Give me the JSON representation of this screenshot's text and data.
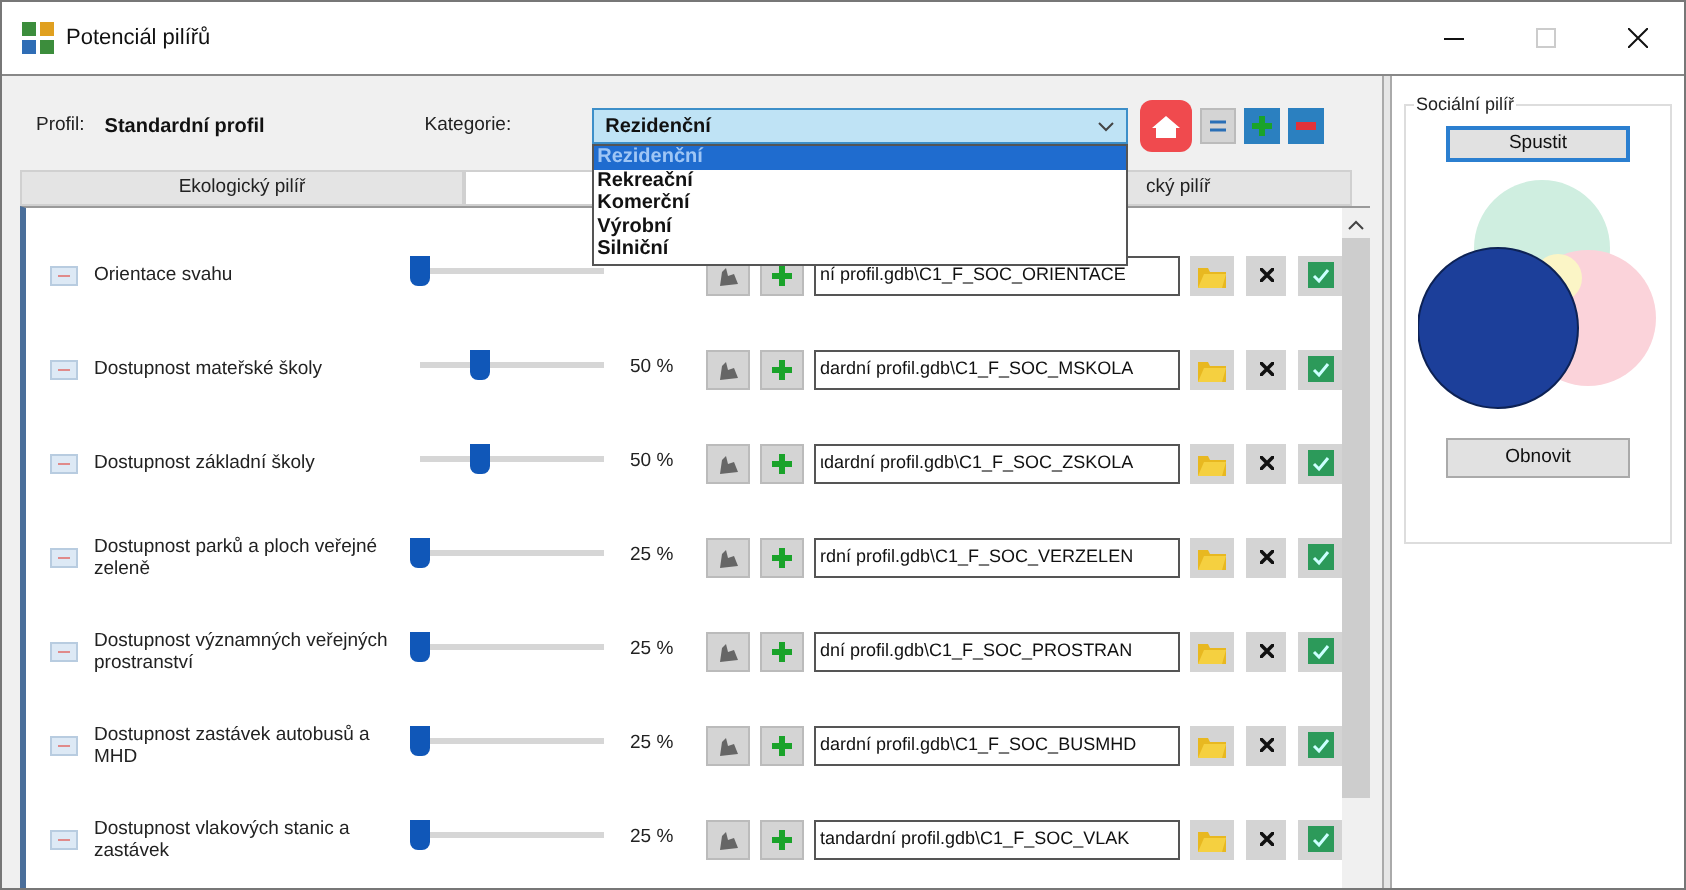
{
  "window": {
    "title": "Potenciál pilířů",
    "maximize_disabled": true
  },
  "profile": {
    "label": "Profil:",
    "value": "Standardní profil"
  },
  "category": {
    "label": "Kategorie:",
    "value": "Rezidenční",
    "expanded": true,
    "options": [
      {
        "label": "Rezidenční",
        "selected": true
      },
      {
        "label": "Rekreační",
        "selected": false
      },
      {
        "label": "Komerční",
        "selected": false
      },
      {
        "label": "Výrobní",
        "selected": false
      },
      {
        "label": "Silniční",
        "selected": false
      }
    ]
  },
  "tabs": [
    {
      "label": "Ekologický pilíř",
      "selected": false
    },
    {
      "selected": true
    },
    {
      "label": "cký pilíř",
      "selected": false
    }
  ],
  "rows": [
    {
      "label": "Orientace svahu",
      "level": 0,
      "path": "ní profil.gdb\\C1_F_SOC_ORIENTACE"
    },
    {
      "label": "Dostupnost mateřské školy",
      "level": 0.33,
      "percent": "50 %",
      "path": "dardní profil.gdb\\C1_F_SOC_MSKOLA"
    },
    {
      "label": "Dostupnost základní školy",
      "level": 0.33,
      "percent": "50 %",
      "path": "ιdardní profil.gdb\\C1_F_SOC_ZSKOLA"
    },
    {
      "label": "Dostupnost parků a ploch veřejné zeleně",
      "level": 0,
      "percent": "25 %",
      "path": "rdní profil.gdb\\C1_F_SOC_VERZELEN"
    },
    {
      "label": "Dostupnost významných veřejných prostranství",
      "level": 0,
      "percent": "25 %",
      "path": "dní profil.gdb\\C1_F_SOC_PROSTRAN"
    },
    {
      "label": "Dostupnost zastávek autobusů a MHD",
      "level": 0,
      "percent": "25 %",
      "path": "dardní profil.gdb\\C1_F_SOC_BUSMHD"
    },
    {
      "label": "Dostupnost vlakových stanic a zastávek",
      "level": 0,
      "percent": "25 %",
      "path": "tandardní profil.gdb\\C1_F_SOC_VLAK"
    }
  ],
  "side_panel": {
    "title": "Sociální pilíř",
    "run_button": "Spustit",
    "refresh_button": "Obnovit"
  }
}
